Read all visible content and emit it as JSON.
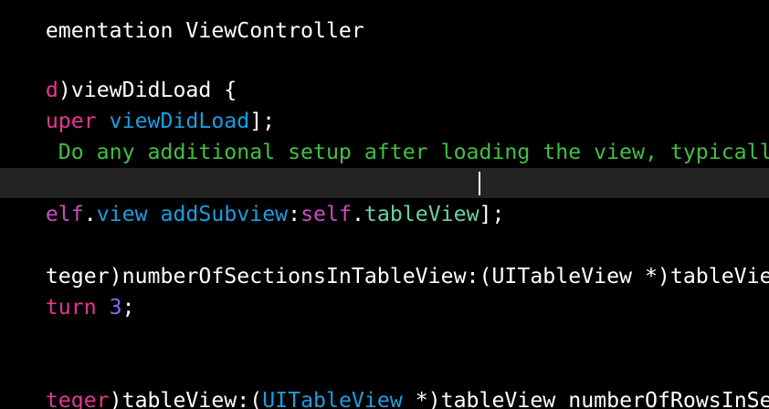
{
  "colors": {
    "background": "#000000",
    "current_line_highlight": "#232323",
    "plain": "#ffffff",
    "keyword": "#e8368f",
    "method": "#1b9ee0",
    "self_keyword": "#c74ec0",
    "property": "#6bd2a8",
    "comment": "#41c043",
    "number": "#7c6df0"
  },
  "editor": {
    "line1": {
      "t1": "ementation ViewController"
    },
    "line2": {
      "t1": "d",
      "t2": ")viewDidLoad {"
    },
    "line3": {
      "t1": "uper",
      "t2": " ",
      "t3": "viewDidLoad",
      "t4": "];"
    },
    "line4": {
      "t1": " Do any additional setup after loading the view, typically"
    },
    "line5": {
      "t1": "elf",
      "t2": ".",
      "t3": "view",
      "t4": " ",
      "t5": "addSubview",
      "t6": ":",
      "t7": "self",
      "t8": ".",
      "t9": "tableView",
      "t10": "];"
    },
    "line6": {
      "t1": "teger)numberOfSectionsInTableView:(UITableView *)tableView"
    },
    "line7": {
      "t1": "turn",
      "t2": " ",
      "t3": "3",
      "t4": ";"
    },
    "line8": {
      "t1": "teger",
      "t2": ")tableView:(",
      "t3": "UITableView",
      "t4": " *)tableView numberOfRowsInSec"
    }
  }
}
